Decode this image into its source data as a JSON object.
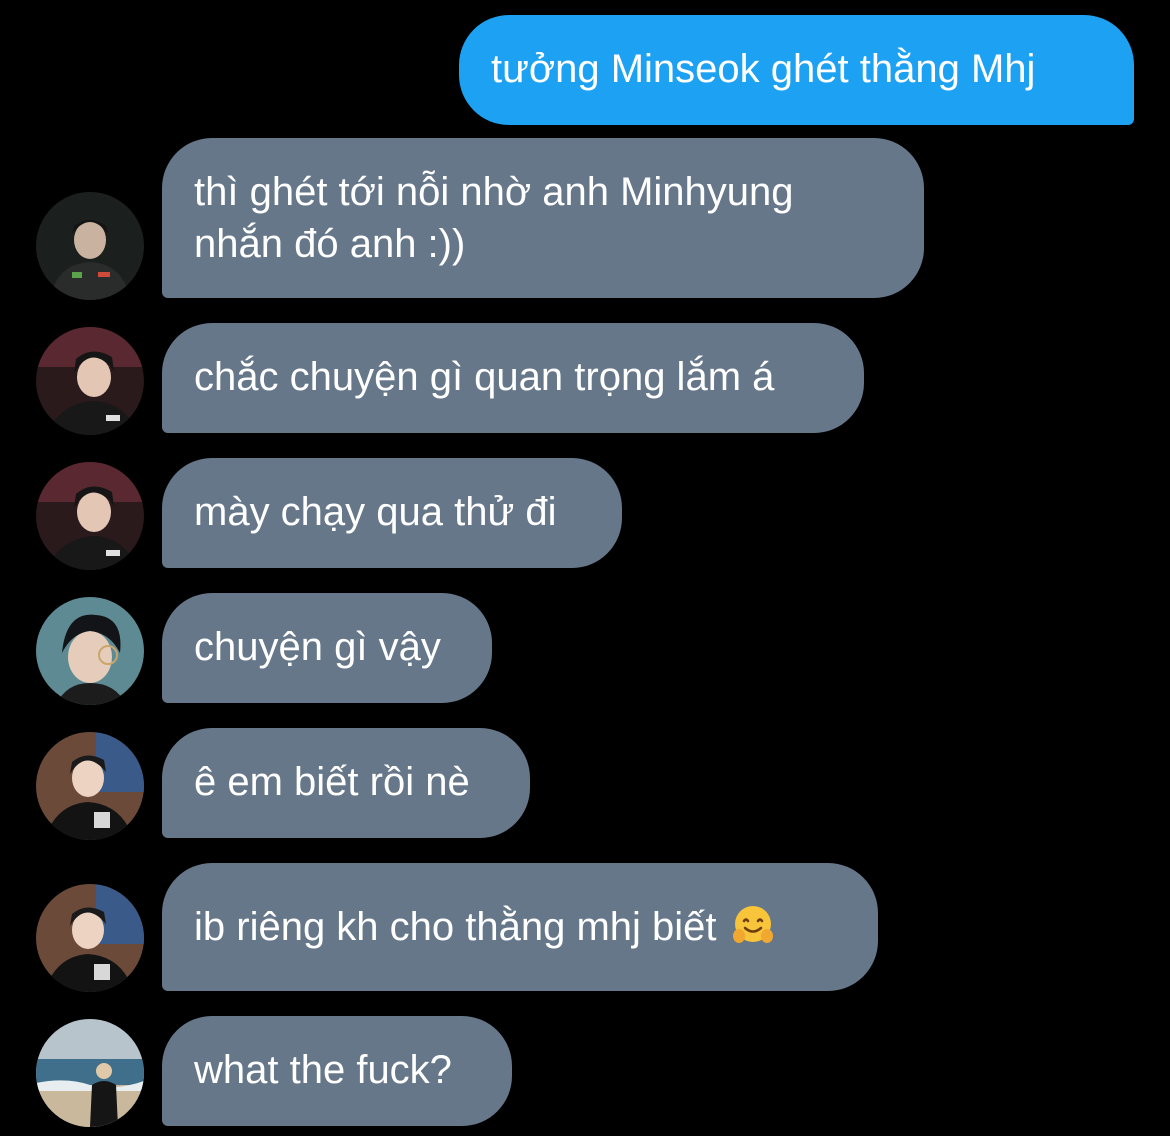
{
  "colors": {
    "background": "#000000",
    "outgoing_bubble": "#1da1f2",
    "incoming_bubble": "#66778a",
    "text": "#ffffff"
  },
  "messages": [
    {
      "direction": "outgoing",
      "lines": [
        "tưởng Minseok ghét thằng Mhj"
      ]
    },
    {
      "direction": "incoming",
      "avatar": "avatar-1",
      "lines": [
        "thì ghét tới nỗi nhờ anh Minhyung",
        "nhắn đó anh :))"
      ]
    },
    {
      "direction": "incoming",
      "avatar": "avatar-2",
      "lines": [
        "chắc chuyện gì quan trọng lắm á"
      ]
    },
    {
      "direction": "incoming",
      "avatar": "avatar-2",
      "lines": [
        "mày chạy qua thử đi"
      ]
    },
    {
      "direction": "incoming",
      "avatar": "avatar-3",
      "lines": [
        "chuyện gì vậy"
      ]
    },
    {
      "direction": "incoming",
      "avatar": "avatar-4",
      "lines": [
        "ê em biết rồi nè"
      ]
    },
    {
      "direction": "incoming",
      "avatar": "avatar-4",
      "lines": [
        "ib riêng kh cho thằng mhj biết"
      ],
      "emoji": "hugging-face-emoji"
    },
    {
      "direction": "incoming",
      "avatar": "avatar-5",
      "lines": [
        "what the fuck?"
      ]
    }
  ]
}
